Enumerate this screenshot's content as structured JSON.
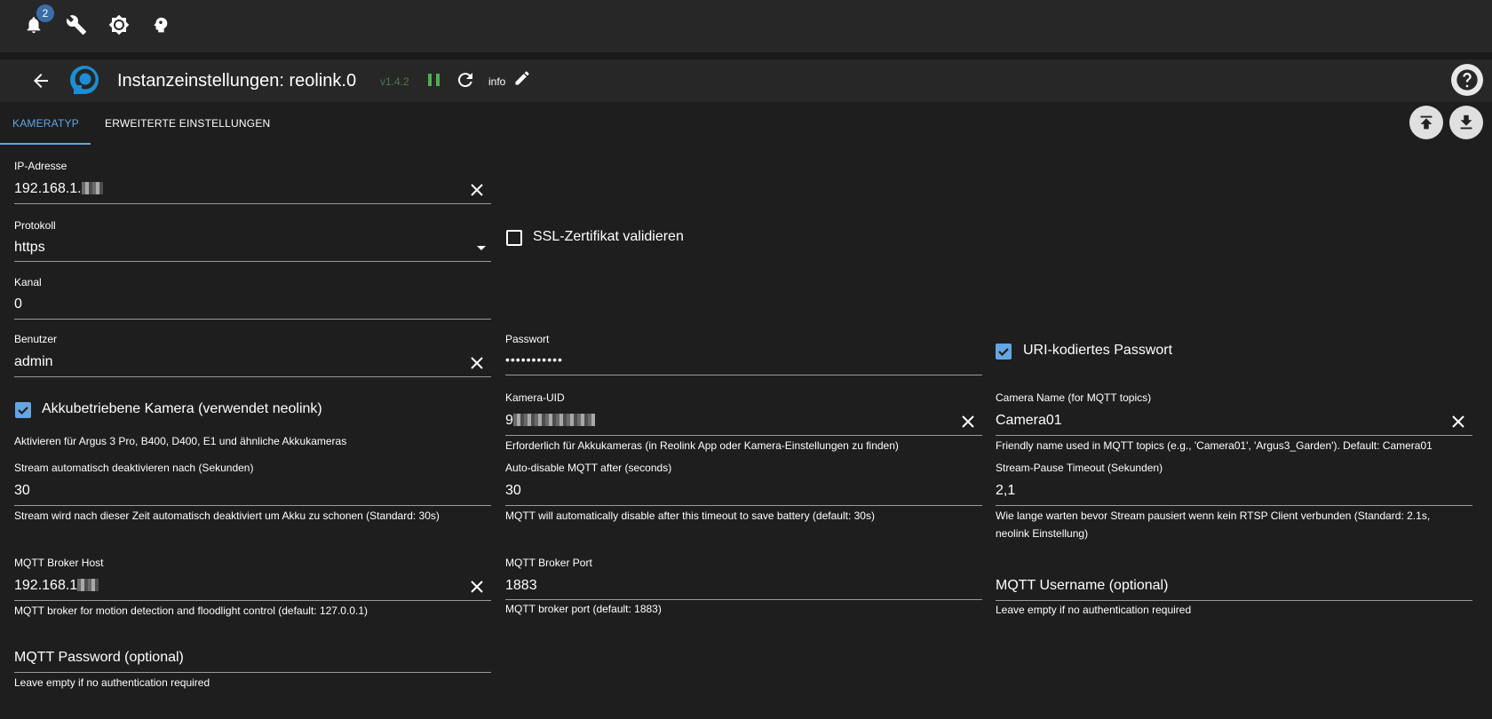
{
  "topbar": {
    "icons": [
      "bell-icon",
      "wrench-icon",
      "brightness-icon",
      "head-icon"
    ],
    "notification_count": "2"
  },
  "header": {
    "title": "Instanzeinstellungen:  reolink.0",
    "version": "v1.4.2",
    "info_label": "info"
  },
  "tabs": {
    "items": [
      "KAMERATYP",
      "ERWEITERTE EINSTELLUNGEN"
    ],
    "active": "KAMERATYP"
  },
  "form": {
    "ip": {
      "label": "IP-Adresse",
      "value": "192.168.1."
    },
    "protocol": {
      "label": "Protokoll",
      "value": "https"
    },
    "ssl": {
      "label": "SSL-Zertifikat validieren",
      "checked": false
    },
    "channel": {
      "label": "Kanal",
      "value": "0"
    },
    "user": {
      "label": "Benutzer",
      "value": "admin"
    },
    "password": {
      "label": "Passwort",
      "value": "•••••••••••"
    },
    "uri_password": {
      "label": "URI-kodiertes Passwort",
      "checked": true
    },
    "battery": {
      "label": "Akkubetriebene Kamera (verwendet neolink)",
      "checked": true,
      "help": "Aktivieren für Argus 3 Pro, B400, D400, E1 und ähnliche Akkukameras"
    },
    "uid": {
      "label": "Kamera-UID",
      "value": "9",
      "help": "Erforderlich für Akkukameras (in Reolink App oder Kamera-Einstellungen zu finden)"
    },
    "camera_name": {
      "label": "Camera Name (for MQTT topics)",
      "value": "Camera01",
      "help": "Friendly name used in MQTT topics (e.g., 'Camera01', 'Argus3_Garden'). Default: Camera01"
    },
    "stream_disable": {
      "label": "Stream automatisch deaktivieren nach (Sekunden)",
      "value": "30",
      "help": "Stream wird nach dieser Zeit automatisch deaktiviert um Akku zu schonen (Standard: 30s)"
    },
    "mqtt_disable": {
      "label": "Auto-disable MQTT after (seconds)",
      "value": "30",
      "help": "MQTT will automatically disable after this timeout to save battery (default: 30s)"
    },
    "stream_pause": {
      "label": "Stream-Pause Timeout (Sekunden)",
      "value": "2,1",
      "help_line1": "Wie lange warten bevor Stream pausiert wenn kein RTSP Client verbunden (Standard: 2.1s,",
      "help_line2": "neolink Einstellung)"
    },
    "mqtt_host": {
      "label": "MQTT Broker Host",
      "value": "192.168.1",
      "help": "MQTT broker for motion detection and floodlight control (default: 127.0.0.1)"
    },
    "mqtt_port": {
      "label": "MQTT Broker Port",
      "value": "1883",
      "help": "MQTT broker port (default: 1883)"
    },
    "mqtt_user": {
      "placeholder": "MQTT Username (optional)",
      "help": "Leave empty if no authentication required"
    },
    "mqtt_pass": {
      "placeholder": "MQTT Password (optional)",
      "help": "Leave empty if no authentication required"
    }
  }
}
